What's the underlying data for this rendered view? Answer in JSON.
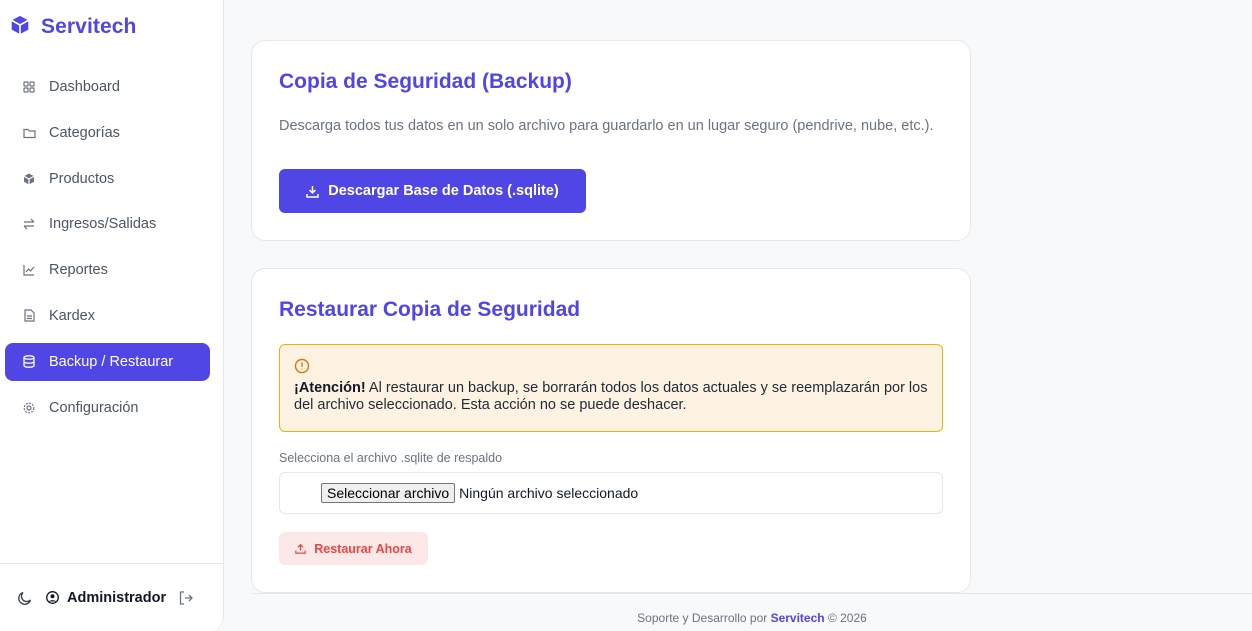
{
  "app": {
    "brand": "Servitech"
  },
  "sidebar": {
    "items": [
      {
        "label": "Dashboard",
        "icon": "grid-icon"
      },
      {
        "label": "Categorías",
        "icon": "folder-icon"
      },
      {
        "label": "Productos",
        "icon": "box-icon"
      },
      {
        "label": "Ingresos/Salidas",
        "icon": "arrows-exchange-icon"
      },
      {
        "label": "Reportes",
        "icon": "chart-line-icon"
      },
      {
        "label": "Kardex",
        "icon": "file-text-icon"
      },
      {
        "label": "Backup / Restaurar",
        "icon": "database-icon",
        "active": true
      },
      {
        "label": "Configuración",
        "icon": "gear-icon"
      }
    ],
    "footer": {
      "user": "Administrador"
    }
  },
  "backup": {
    "title": "Copia de Seguridad (Backup)",
    "description": "Descarga todos tus datos en un solo archivo para guardarlo en un lugar seguro (pendrive, nube, etc.).",
    "button": "Descargar Base de Datos (.sqlite)"
  },
  "restore": {
    "title": "Restaurar Copia de Seguridad",
    "warning_strong": "¡Atención!",
    "warning_text": " Al restaurar un backup, se borrarán todos los datos actuales y se reemplazarán por los del archivo seleccionado. Esta acción no se puede deshacer.",
    "file_label": "Selecciona el archivo .sqlite de respaldo",
    "file_button": "Seleccionar archivo",
    "file_status": "Ningún archivo seleccionado",
    "button": "Restaurar Ahora"
  },
  "footer": {
    "prefix": "Soporte y Desarrollo por ",
    "brand": "Servitech",
    "suffix": " © 2026"
  },
  "colors": {
    "accent": "#4f46e5",
    "danger": "#ef4444",
    "warning_bg": "#fef3e2",
    "warning_border": "#eab308"
  }
}
